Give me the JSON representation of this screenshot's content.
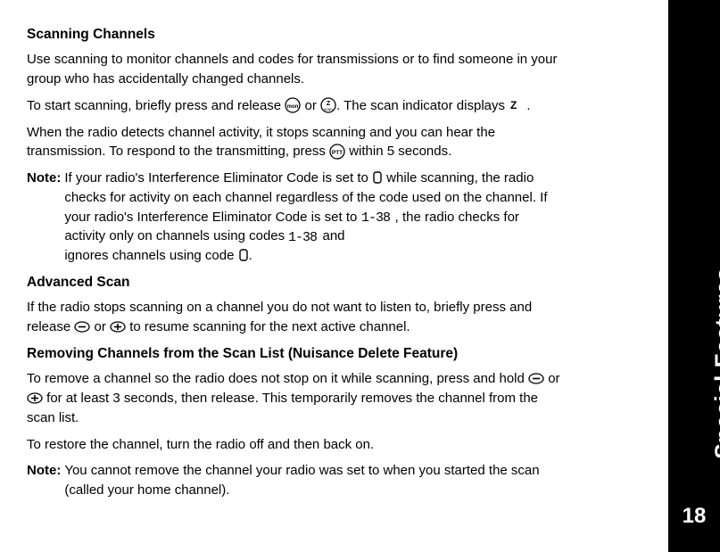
{
  "side": {
    "label": "Special Features",
    "page": "18"
  },
  "section1": {
    "heading": "Scanning Channels",
    "p1a": "Use scanning to monitor channels and codes for transmissions or to find someone in your group who has accidentally changed channels.",
    "p2a": "To start scanning, briefly press and release ",
    "p2b": " or ",
    "p2c": ". The scan indicator displays ",
    "p2d": " .",
    "p3a": "When the radio detects channel activity, it stops scanning and you can hear the transmission. To respond to the transmitting, press ",
    "p3b": " within 5 seconds.",
    "noteLabel": "Note:",
    "note1a": "If your radio's Interference Eliminator Code is set to ",
    "note1b": " while scanning, the radio checks for activity on each channel regardless of the code used on the channel. If your radio's Interference Eliminator Code is set to ",
    "note1c": " , the radio checks for activity only on channels using codes ",
    "note1d": " and",
    "note1e": "ignores channels using code ",
    "note1f": "."
  },
  "section2": {
    "heading": "Advanced Scan",
    "p1a": "If the radio stops scanning on a channel you do not want to listen to, briefly press and release ",
    "p1b": " or ",
    "p1c": " to resume scanning for the next active channel."
  },
  "section3": {
    "heading": "Removing Channels from the Scan List (Nuisance Delete Feature)",
    "p1a": "To remove a channel so the radio does not stop on it while scanning, press and hold ",
    "p1b": " or ",
    "p1c": " for at least 3 seconds, then release. This temporarily removes the channel from the scan list.",
    "p2": "To restore the channel, turn the radio off and then back on.",
    "noteLabel": "Note:",
    "note1": "You cannot remove the channel your radio was set to when you started the scan (called your home channel)."
  }
}
